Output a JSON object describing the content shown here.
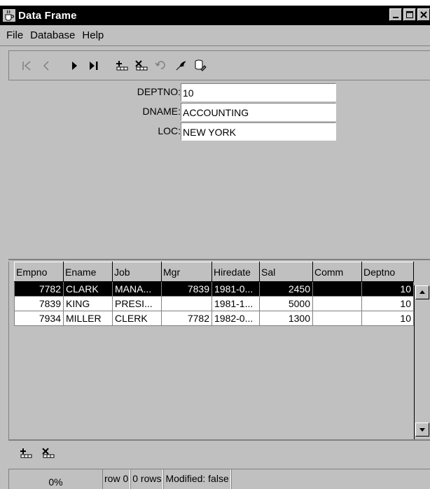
{
  "window": {
    "title": "Data Frame",
    "icon": "java-cup-icon"
  },
  "menu": {
    "items": [
      {
        "label": "File"
      },
      {
        "label": "Database"
      },
      {
        "label": "Help"
      }
    ]
  },
  "toolbar": {
    "buttons": [
      {
        "icon": "first-record-icon",
        "enabled": false
      },
      {
        "icon": "previous-record-icon",
        "enabled": false
      },
      {
        "icon": "next-record-icon",
        "enabled": true
      },
      {
        "icon": "last-record-icon",
        "enabled": true
      },
      {
        "icon": "insert-row-icon",
        "enabled": true
      },
      {
        "icon": "delete-row-icon",
        "enabled": true
      },
      {
        "icon": "undo-icon",
        "enabled": false
      },
      {
        "icon": "revert-icon",
        "enabled": true
      },
      {
        "icon": "save-database-icon",
        "enabled": true
      }
    ]
  },
  "form": {
    "fields": [
      {
        "label": "DEPTNO:",
        "value": "10"
      },
      {
        "label": "DNAME:",
        "value": "ACCOUNTING"
      },
      {
        "label": "LOC:",
        "value": "NEW YORK"
      }
    ]
  },
  "grid": {
    "columns": [
      "Empno",
      "Ename",
      "Job",
      "Mgr",
      "Hiredate",
      "Sal",
      "Comm",
      "Deptno"
    ],
    "rows": [
      {
        "empno": "7782",
        "ename": "CLARK",
        "job": "MANA...",
        "mgr": "7839",
        "hiredate": "1981-0...",
        "sal": "2450",
        "comm": "",
        "deptno": "10"
      },
      {
        "empno": "7839",
        "ename": "KING",
        "job": "PRESI...",
        "mgr": "",
        "hiredate": "1981-1...",
        "sal": "5000",
        "comm": "",
        "deptno": "10"
      },
      {
        "empno": "7934",
        "ename": "MILLER",
        "job": "CLERK",
        "mgr": "7782",
        "hiredate": "1982-0...",
        "sal": "1300",
        "comm": "",
        "deptno": "10"
      }
    ],
    "selected_row": 0
  },
  "bottom_toolbar": {
    "buttons": [
      {
        "icon": "insert-row-icon"
      },
      {
        "icon": "delete-row-icon"
      }
    ]
  },
  "status": {
    "progress": "0%",
    "row": "row 0",
    "rows": "0 rows",
    "modified": "Modified: false"
  },
  "colors": {
    "face": "#c0c0c0",
    "selection": "#000000",
    "titlebar": "#000000"
  }
}
